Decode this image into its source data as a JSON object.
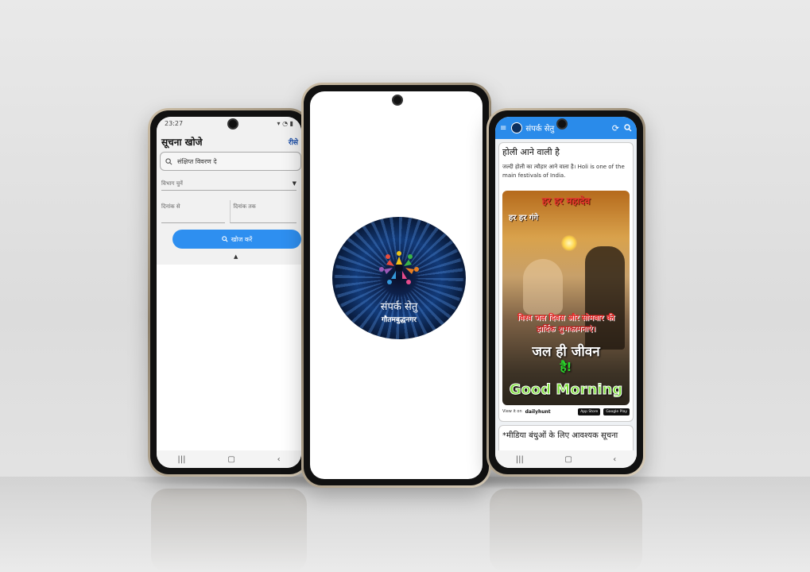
{
  "left_phone": {
    "status_time": "23:27",
    "title": "सूचना खोजे",
    "reset_label": "रीसे",
    "search_placeholder": "संक्षिप्त विवरण दे",
    "department_label": "विभाग चुनें",
    "date_from_label": "दिनांक से",
    "date_to_label": "दिनांक तक",
    "search_button_label": "खोज करें"
  },
  "center_phone": {
    "logo_line1": "संपर्क सेतु",
    "logo_line2": "गौतमबुद्धनगर"
  },
  "right_phone": {
    "app_title": "संपर्क सेतु",
    "post1": {
      "title": "होली आने वाली है",
      "description": "जल्दी होली का त्यौहार आने वाला है। Holi is one of the main festivals of India.",
      "poster_line1": "हर हर महादेव",
      "poster_line2": "हर हर गंगे",
      "poster_line3": "विश्व जल दिवस और सोमवार की",
      "poster_line4": "हार्दिक शुभकामनाएं।",
      "poster_line5": "जल ही जीवन",
      "poster_line6": "है!",
      "poster_line7": "Good Morning",
      "view_label": "View it on",
      "brand": "dailyhunt",
      "app_store_label": "App Store",
      "play_store_label": "Google Play"
    },
    "post2": {
      "title": "*मीडिया बंधुओं के लिए आवश्यक सूचना"
    }
  },
  "colors": {
    "primary": "#2a8bea",
    "button": "#2e8ff0",
    "reset": "#1a4da8"
  }
}
